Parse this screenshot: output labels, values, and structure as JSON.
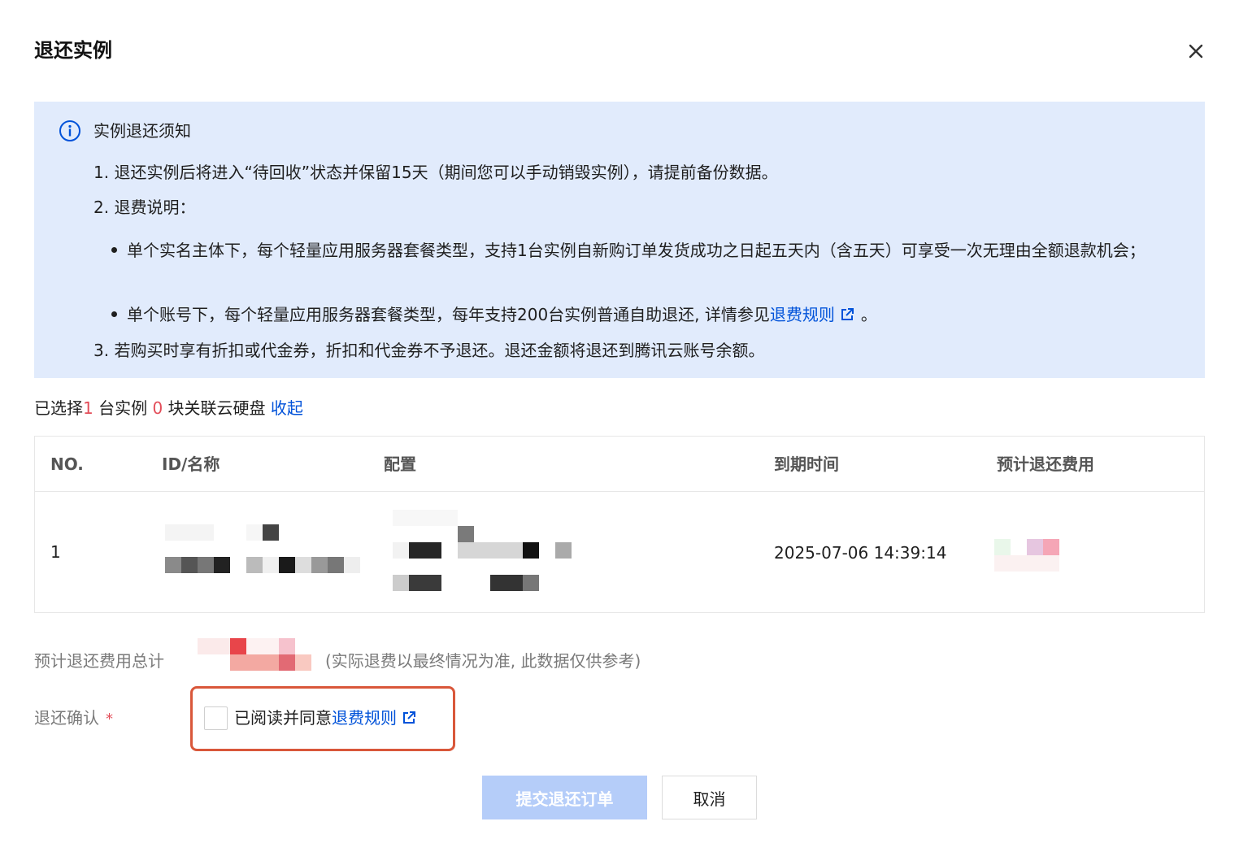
{
  "dialog": {
    "title": "退还实例"
  },
  "notice": {
    "title": "实例退还须知",
    "line1": "1. 退还实例后将进入“待回收”状态并保留15天（期间您可以手动销毁实例），请提前备份数据。",
    "line2": "2. 退费说明：",
    "bullet1": "单个实名主体下，每个轻量应用服务器套餐类型，支持1台实例自新购订单发货成功之日起五天内（含五天）可享受一次无理由全额退款机会；",
    "bullet2_prefix": "单个账号下，每个轻量应用服务器套餐类型，每年支持200台实例普通自助退还, 详情参见",
    "bullet2_link": "退费规则",
    "bullet2_suffix": "。",
    "line3": "3. 若购买时享有折扣或代金券，折扣和代金券不予退还。退还金额将退还到腾讯云账号余额。"
  },
  "selection": {
    "prefix": "已选择",
    "instance_count": "1",
    "instance_unit": " 台实例 ",
    "disk_count": "0",
    "disk_unit": " 块关联云硬盘 ",
    "collapse_label": "收起"
  },
  "table": {
    "headers": [
      "NO.",
      "ID/名称",
      "配置",
      "到期时间",
      "预计退还费用"
    ],
    "rows": [
      {
        "no": "1",
        "expire_time": "2025-07-06 14:39:14"
      }
    ]
  },
  "form": {
    "total_label": "预计退还费用总计",
    "total_hint": "(实际退费以最终情况为准, 此数据仅供参考)",
    "confirm_label": "退还确认",
    "required_mark": "*",
    "agree_text": "已阅读并同意",
    "agree_link": "退费规则"
  },
  "buttons": {
    "submit": "提交退还订单",
    "cancel": "取消"
  },
  "colors": {
    "primary": "#0052d9",
    "notice_bg": "#e1ebfc",
    "danger": "#e34d59",
    "highlight_border": "#d9573a",
    "disabled_btn": "#b5cdf9"
  }
}
